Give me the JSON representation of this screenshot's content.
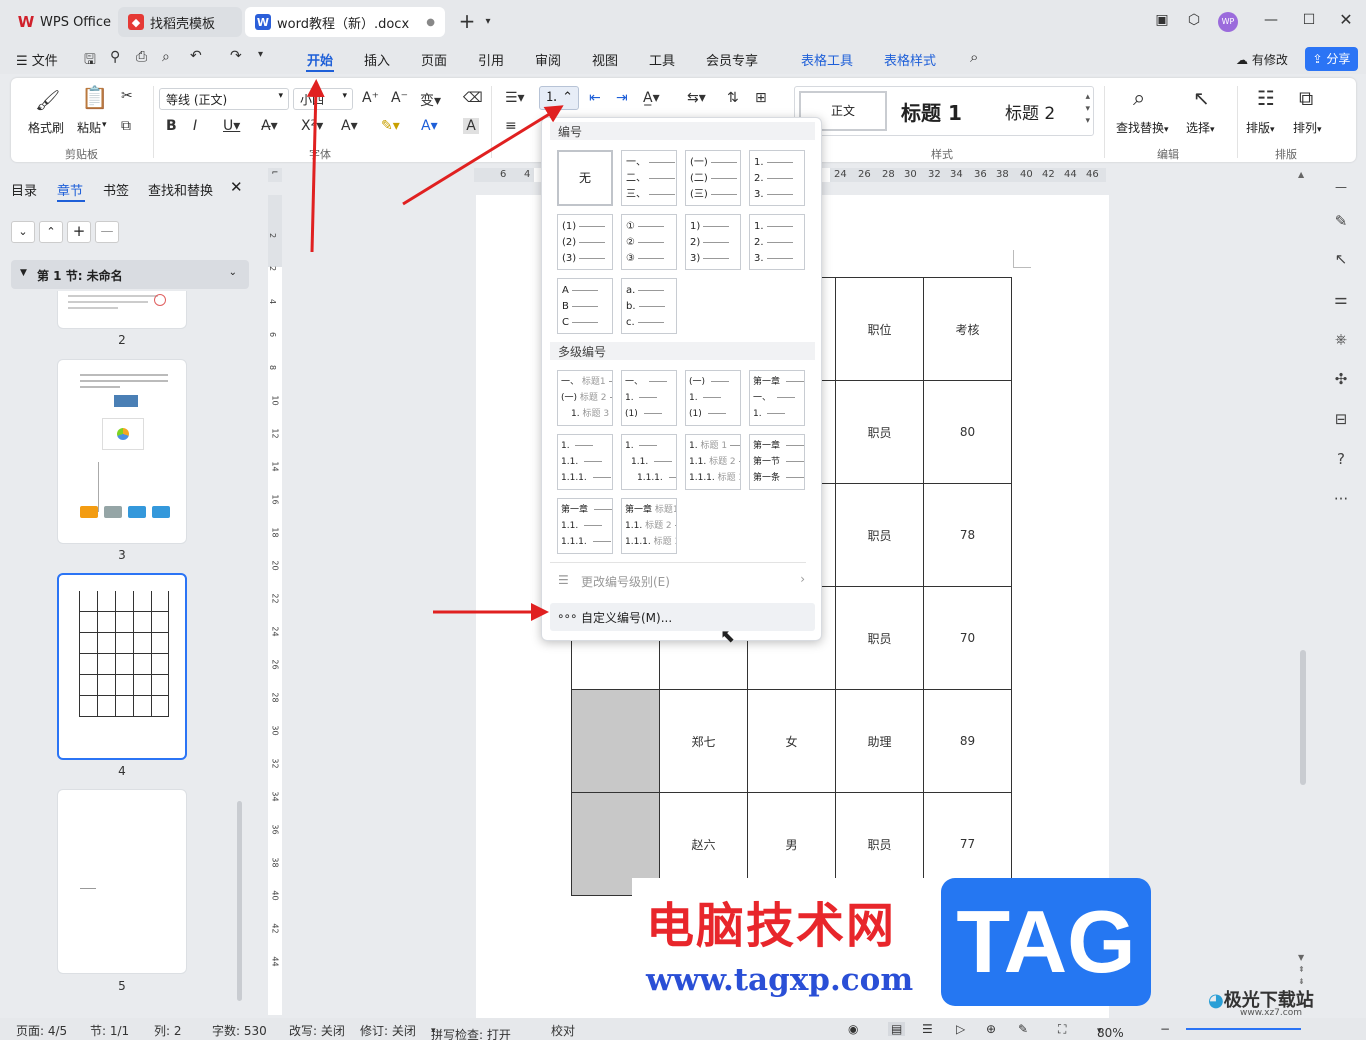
{
  "titlebar": {
    "tabs": [
      {
        "label": "WPS Office",
        "icon": "wps-logo-icon"
      },
      {
        "label": "找稻壳模板",
        "icon": "docer-logo-icon"
      },
      {
        "label": "word教程（新）.docx",
        "icon": "word-doc-icon",
        "dot": "●"
      }
    ],
    "new_tab": "+",
    "avatar": "WP"
  },
  "menubar": {
    "file": "文件",
    "items": [
      "开始",
      "插入",
      "页面",
      "引用",
      "审阅",
      "视图",
      "工具",
      "会员专享"
    ],
    "context_items": [
      "表格工具",
      "表格样式"
    ],
    "has_changes": "有修改",
    "share": "分享"
  },
  "ribbon": {
    "format_painter": "格式刷",
    "paste": "粘贴",
    "clipboard_group": "剪贴板",
    "font_name": "等线 (正文)",
    "font_size": "小四",
    "font_group": "字体",
    "styles": [
      "正文",
      "标题 1",
      "标题 2"
    ],
    "styles_group": "样式",
    "find_replace": "查找替换",
    "select": "选择",
    "edit_group": "编辑",
    "layout": "排版",
    "arrange": "排列",
    "layout_group": "排版",
    "accent_color": "#1e5fd8"
  },
  "leftpanel": {
    "tabs": [
      "目录",
      "章节",
      "书签",
      "查找和替换"
    ],
    "active_tab": "章节",
    "section_title": "第 1 节: 未命名",
    "page_numbers": [
      "2",
      "3",
      "4",
      "5"
    ]
  },
  "ruler": {
    "h_ticks": [
      "6",
      "4",
      "24",
      "26",
      "28",
      "30",
      "32",
      "34",
      "36",
      "38",
      "40",
      "42",
      "44",
      "46"
    ],
    "v_ticks": [
      "2",
      "2",
      "4",
      "6",
      "8",
      "10",
      "12",
      "14",
      "16",
      "18",
      "20",
      "22",
      "24",
      "26",
      "28",
      "30",
      "32",
      "34",
      "36",
      "38",
      "40",
      "42",
      "44"
    ]
  },
  "document": {
    "rows": [
      [
        "",
        "",
        "",
        "职位",
        "考核"
      ],
      [
        "",
        "",
        "",
        "职员",
        "80"
      ],
      [
        "",
        "",
        "",
        "职员",
        "78"
      ],
      [
        "",
        "",
        "",
        "职员",
        "70"
      ],
      [
        "",
        "郑七",
        "女",
        "助理",
        "89"
      ],
      [
        "",
        "赵六",
        "男",
        "职员",
        "77"
      ]
    ]
  },
  "dropdown": {
    "numbering_header": "编号",
    "none_label": "无",
    "single_cells": [
      [
        "一、",
        "二、",
        "三、"
      ],
      [
        "(一)",
        "(二)",
        "(三)"
      ],
      [
        "1.",
        "2.",
        "3."
      ],
      [
        "(1)",
        "(2)",
        "(3)"
      ],
      [
        "①",
        "②",
        "③"
      ],
      [
        "1)",
        "2)",
        "3)"
      ],
      [
        "1.",
        "2.",
        "3."
      ],
      [
        "A",
        "B",
        "C"
      ],
      [
        "a.",
        "b.",
        "c."
      ]
    ],
    "multilevel_header": "多级编号",
    "multi_cells": [
      [
        [
          "一、",
          "标题1"
        ],
        [
          "(一)",
          "标题 2"
        ],
        [
          "1.",
          "标题 3"
        ]
      ],
      [
        [
          "一、",
          ""
        ],
        [
          "1.",
          ""
        ],
        [
          "(1)",
          ""
        ]
      ],
      [
        [
          "(一)",
          ""
        ],
        [
          "1.",
          ""
        ],
        [
          "(1)",
          ""
        ]
      ],
      [
        [
          "第一章",
          ""
        ],
        [
          "一、",
          ""
        ],
        [
          "1.",
          ""
        ]
      ],
      [
        [
          "1.",
          ""
        ],
        [
          "1.1.",
          ""
        ],
        [
          "1.1.1.",
          ""
        ]
      ],
      [
        [
          "1.",
          ""
        ],
        [
          "1.1.",
          ""
        ],
        [
          "1.1.1.",
          ""
        ]
      ],
      [
        [
          "1.",
          "标题 1"
        ],
        [
          "1.1.",
          "标题 2"
        ],
        [
          "1.1.1.",
          "标题 3"
        ]
      ],
      [
        [
          "第一章",
          ""
        ],
        [
          "第一节",
          ""
        ],
        [
          "第一条",
          ""
        ]
      ],
      [
        [
          "第一章",
          ""
        ],
        [
          "1.1.",
          ""
        ],
        [
          "1.1.1.",
          ""
        ]
      ],
      [
        [
          "第一章",
          "标题1"
        ],
        [
          "1.1.",
          "标题 2"
        ],
        [
          "1.1.1.",
          "标题 3"
        ]
      ]
    ],
    "change_level": "更改编号级别(E)",
    "custom": "自定义编号(M)..."
  },
  "status": {
    "page": "页面: 4/5",
    "section": "节: 1/1",
    "column": "列: 2",
    "words": "字数: 530",
    "revise": "改写: 关闭",
    "track": "修订: 关闭",
    "spell": "拼写检查: 打开",
    "proof": "校对",
    "zoom": "80%"
  },
  "watermark": {
    "cn": "电脑技术网",
    "url": "www.tagxp.com",
    "tag": "TAG",
    "site": "极光下载站",
    "site_url": "www.xz7.com"
  }
}
